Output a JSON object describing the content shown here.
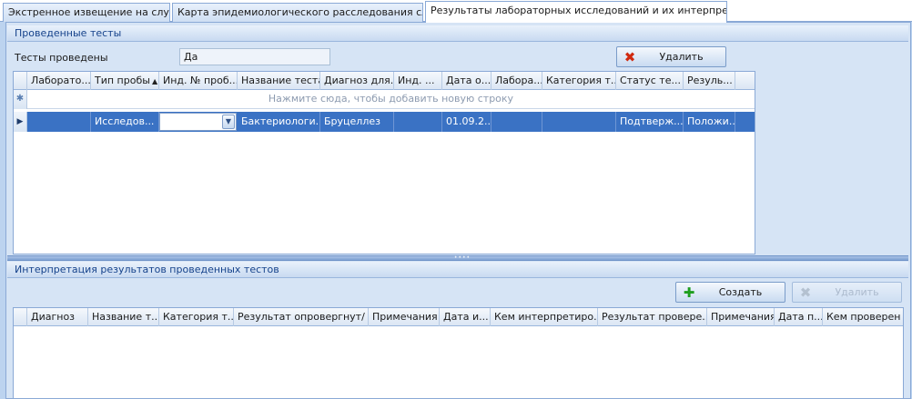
{
  "tabs": [
    {
      "label": "Экстренное извещение на случай",
      "active": false
    },
    {
      "label": "Карта эпидемиологического расследования случая",
      "active": false
    },
    {
      "label": "Результаты лабораторных исследований и их интерпретация",
      "active": true
    }
  ],
  "tests_section": {
    "title": "Проведенные тесты",
    "tests_done_label": "Тесты проведены",
    "tests_done_value": "Да",
    "delete_button": "Удалить",
    "grid": {
      "columns": [
        "Лаборато...",
        "Тип пробы",
        "Инд. № проб...",
        "Название теста",
        "Диагноз для...",
        "Инд. ...",
        "Дата о...",
        "Лабора...",
        "Категория т...",
        "Статус те...",
        "Резуль..."
      ],
      "sorted_column": 1,
      "new_row_hint": "Нажмите сюда, чтобы добавить новую строку",
      "new_row_marker": "✱",
      "rows": [
        [
          "",
          "Исследов...",
          "",
          "Бактериологи...",
          "Бруцеллез",
          "",
          "01.09.2...",
          "",
          "",
          "Подтверж...",
          "Положи..."
        ]
      ]
    }
  },
  "interpretation_section": {
    "title": "Интерпретация результатов проведенных тестов",
    "create_button": "Создать",
    "delete_button": "Удалить",
    "grid": {
      "columns": [
        "Диагноз",
        "Название т...",
        "Категория т...",
        "Результат опровергнут/ ...",
        "Примечания",
        "Дата и...",
        "Кем интерпретиро...",
        "Результат провере...",
        "Примечания",
        "Дата п...",
        "Кем проверен"
      ],
      "rows": []
    }
  },
  "colors": {
    "selected_row": "#3a72c4",
    "section_header_text": "#15428b",
    "background": "#d6e4f5"
  }
}
